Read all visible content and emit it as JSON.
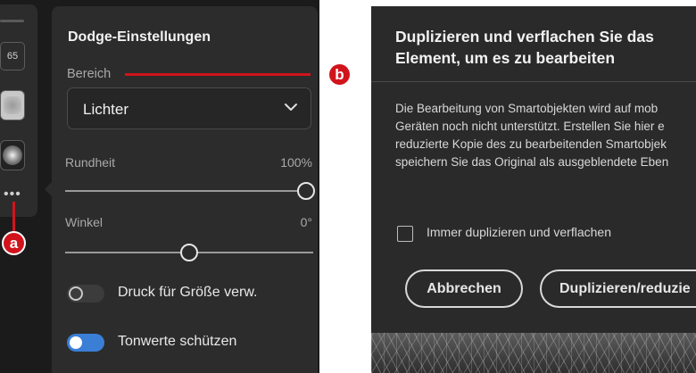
{
  "tool_strip": {
    "brush_size": "65",
    "more_label": "•••"
  },
  "dodge_panel": {
    "title": "Dodge-Einstellungen",
    "range_label": "Bereich",
    "range_value": "Lichter",
    "roundness": {
      "label": "Rundheit",
      "value": "100%",
      "level": 1.0
    },
    "angle": {
      "label": "Winkel",
      "value": "0°",
      "level": 0.5
    },
    "pressure_toggle": {
      "label": "Druck für Größe verw.",
      "on": false
    },
    "protect_tones_toggle": {
      "label": "Tonwerte schützen",
      "on": true
    }
  },
  "annotations": {
    "badge_a": "a",
    "badge_b": "b",
    "color": "#d1141c"
  },
  "dialog": {
    "title": "Duplizieren und verflachen Sie das Element, um es zu bearbeiten",
    "body_lines": [
      "Die Bearbeitung von Smartobjekten wird auf mob",
      "Geräten noch nicht unterstützt. Erstellen Sie hier e",
      "reduzierte Kopie des zu bearbeitenden Smartobjek",
      "speichern Sie das Original als ausgeblendete Eben"
    ],
    "checkbox_label": "Immer duplizieren und verflachen",
    "checkbox_checked": false,
    "cancel_label": "Abbrechen",
    "confirm_label": "Duplizieren/reduzie"
  },
  "colors": {
    "toggle_on": "#3a7fd5",
    "panel_bg": "#2c2c2c"
  }
}
